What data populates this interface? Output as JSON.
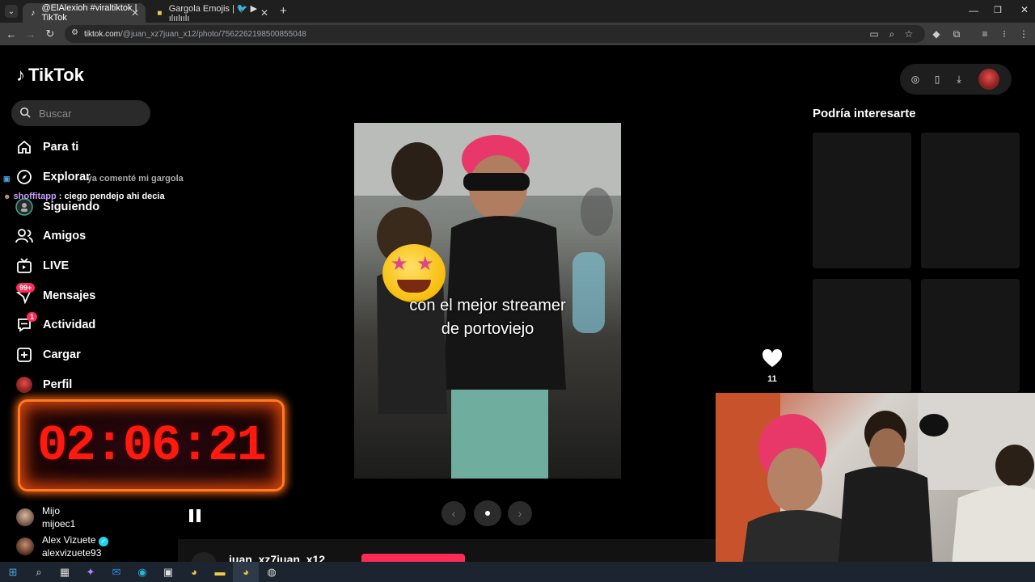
{
  "browser": {
    "tabs": [
      {
        "title": "@ElAlexioh #viraltiktok | TikTok",
        "active": true
      },
      {
        "title": "Gargola Emojis | 🐦 ▶ ılıılıılı",
        "active": false
      }
    ],
    "url_host": "tiktok.com",
    "url_path": "/@juan_xz7juan_x12/photo/7562262198500855048"
  },
  "tiktok": {
    "logo_text": "TikTok",
    "search_placeholder": "Buscar",
    "nav": [
      {
        "label": "Para ti",
        "icon": "home-icon"
      },
      {
        "label": "Explorar",
        "icon": "compass-icon"
      },
      {
        "label": "Siguiendo",
        "icon": "following-icon"
      },
      {
        "label": "Amigos",
        "icon": "friends-icon"
      },
      {
        "label": "LIVE",
        "icon": "live-icon"
      },
      {
        "label": "Mensajes",
        "icon": "messages-icon",
        "badge": "99+"
      },
      {
        "label": "Actividad",
        "icon": "activity-icon",
        "badge": "1"
      },
      {
        "label": "Cargar",
        "icon": "upload-icon"
      },
      {
        "label": "Perfil",
        "icon": "profile-avatar"
      }
    ],
    "following_accounts": [
      {
        "name": "Mijo",
        "handle": "mijoec1",
        "verified": false
      },
      {
        "name": "Alex Vizuete",
        "handle": "alexvizuete93",
        "verified": true
      }
    ],
    "post": {
      "caption_line1": "con el mejor streamer",
      "caption_line2": "de portoviejo",
      "like_count": "11",
      "author": "juan_xz7juan_x12"
    },
    "sidebar_right_title": "Podría interesarte"
  },
  "overlay": {
    "chat": [
      {
        "user": "",
        "text": "ya comenté mi gargola"
      },
      {
        "user": "shoffitapp",
        "text": ": ciego pendejo ahi decia"
      }
    ],
    "timer": "02:06:21"
  },
  "colors": {
    "accent": "#fe2c55",
    "chat_user": "#c9a0ff",
    "timer_red": "#ff1a10"
  }
}
